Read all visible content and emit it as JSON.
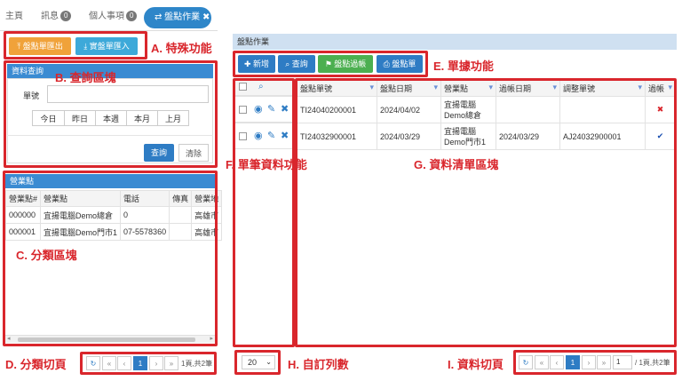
{
  "tabs": [
    {
      "label": "主頁"
    },
    {
      "label": "訊息",
      "badge": "0"
    },
    {
      "label": "個人事項",
      "badge": "0"
    }
  ],
  "active_tab": {
    "label": "盤點作業"
  },
  "special_buttons": {
    "export": "盤點單匯出",
    "import": "實盤單匯入"
  },
  "query_panel": {
    "title": "資料查詢",
    "field_label": "單號",
    "field_value": "",
    "ranges": [
      "今日",
      "昨日",
      "本週",
      "本月",
      "上月"
    ],
    "query_btn": "查詢",
    "clear_btn": "清除"
  },
  "category_panel": {
    "title": "營業點",
    "columns": [
      "營業點#",
      "營業點",
      "電話",
      "傳真",
      "營業地"
    ],
    "rows": [
      [
        "000000",
        "宜揚電腦Demo總倉",
        "0",
        "",
        "高雄市"
      ],
      [
        "000001",
        "宜揚電腦Demo門市1",
        "07-5578360",
        "",
        "高雄市"
      ]
    ]
  },
  "category_pager": {
    "page": "1",
    "info": "1頁,共2筆"
  },
  "main_panel": {
    "title": "盤點作業"
  },
  "doc_buttons": {
    "add": "新增",
    "query": "查詢",
    "post": "盤點過帳",
    "print": "盤點單"
  },
  "main_table": {
    "columns": [
      "盤點單號",
      "盤點日期",
      "營業點",
      "過帳日期",
      "調整單號",
      "過帳"
    ],
    "rows": [
      {
        "no": "TI24040200001",
        "date": "2024/04/02",
        "store_a": "宜揚電腦",
        "store_b": "Demo總倉",
        "post_date": "",
        "adj": "",
        "posted": "✖"
      },
      {
        "no": "TI24032900001",
        "date": "2024/03/29",
        "store_a": "宜揚電腦",
        "store_b": "Demo門市1",
        "post_date": "2024/03/29",
        "adj": "AJ24032900001",
        "posted": "✔"
      }
    ]
  },
  "rows_per_page": "20",
  "main_pager": {
    "page": "1",
    "page_input": "1",
    "info": "/ 1頁,共2筆"
  },
  "annotations": {
    "A": "A. 特殊功能",
    "B": "B. 查詢區塊",
    "C": "C. 分類區塊",
    "D": "D. 分類切頁",
    "E": "E. 單據功能",
    "F": "F. 單筆資料功能",
    "G": "G. 資料清單區塊",
    "H": "H. 自訂列數",
    "I": "I. 資料切頁"
  },
  "colors": {
    "accent": "#2e86c9",
    "annotation": "#d9262c",
    "orange": "#f0a23a",
    "green": "#4caf50"
  }
}
